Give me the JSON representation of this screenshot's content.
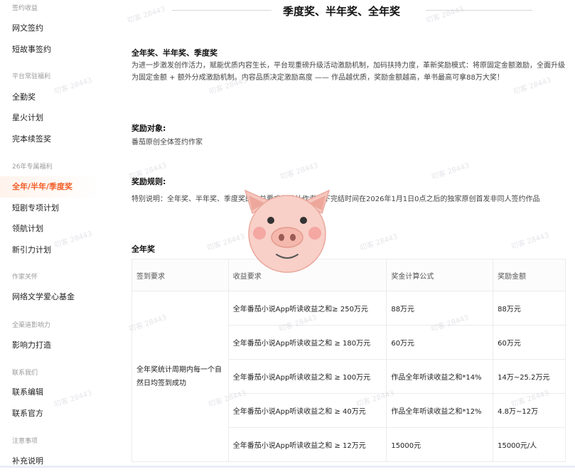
{
  "sidebar": {
    "sections": [
      {
        "title": "签约收益",
        "items": [
          "网文签约",
          "短故事签约"
        ]
      },
      {
        "title": "平台常驻福利",
        "items": [
          "全勤奖",
          "星火计划",
          "完本续签奖"
        ]
      },
      {
        "title": "26年专属福利",
        "items": [
          "全年/半年/季度奖",
          "短剧专项计划",
          "领航计划",
          "新引力计划"
        ]
      },
      {
        "title": "作家关怀",
        "items": [
          "网络文学爱心基金"
        ]
      },
      {
        "title": "全渠道影响力",
        "items": [
          "影响力打造"
        ]
      },
      {
        "title": "联系我们",
        "items": [
          "联系编辑",
          "联系官方"
        ]
      },
      {
        "title": "注意事项",
        "items": [
          "补充说明"
        ]
      }
    ],
    "active_item": "全年/半年/季度奖"
  },
  "header": {
    "title": "季度奖、半年奖、全年奖"
  },
  "content": {
    "intro_heading": "全年奖、半年奖、季度奖",
    "intro_text": "为进一步激发创作活力，赋能优质内容生长，平台现重磅升级活动激励机制，加码扶持力度，革新奖励模式：将原固定金额激励，全面升级为固定金额 + 额外分成激励机制。内容品质决定激励高度 —— 作品越优质，奖励金额越高，单书最高可拿88万大奖！",
    "target_heading": "奖励对象:",
    "target_text": "番茄原创全体签约作家",
    "rules_heading": "奖励规则:",
    "rules_text": "特别说明：全年奖、半年奖、季度奖的收益要求仅统计作者名下完结时间在2026年1月1日0点之后的独家原创首发非同人签约作品",
    "annual_heading": "全年奖"
  },
  "table": {
    "headers": [
      "签到要求",
      "收益要求",
      "奖金计算公式",
      "奖励金额"
    ],
    "signin_requirement": "全年奖统计周期内每一个自然日均签到成功",
    "rows": [
      {
        "income": "全年番茄小说App听读收益之和≥ 250万元",
        "formula": "88万元",
        "amount": "88万元"
      },
      {
        "income": "全年番茄小说App听读收益之和 ≥ 180万元",
        "formula": "60万元",
        "amount": "60万元"
      },
      {
        "income": "全年番茄小说App听读收益之和 ≥ 100万元",
        "formula": "作品全年听读收益之和*14%",
        "amount": "14万~25.2万元"
      },
      {
        "income": "全年番茄小说App听读收益之和 ≥ 40万元",
        "formula": "作品全年听读收益之和*12%",
        "amount": "4.8万~12万"
      },
      {
        "income": "全年番茄小说App听读收益之和 ≥ 12万元",
        "formula": "15000元",
        "amount": "15000元/人"
      }
    ]
  },
  "watermark": {
    "text": "叨客 28443"
  },
  "colors": {
    "accent": "#f25f29",
    "pig_pink": "#f6c7bf"
  },
  "icons": {
    "overlay": "pig-face-icon"
  }
}
